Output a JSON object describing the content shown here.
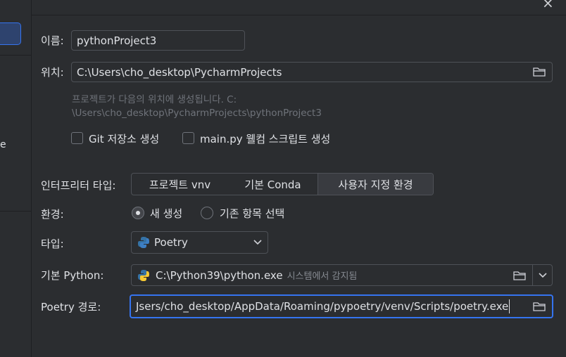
{
  "sidebar": {
    "fragment": "e"
  },
  "form": {
    "name_label": "이름:",
    "name_value": "pythonProject3",
    "location_label": "위치:",
    "location_value": "C:\\Users\\cho_desktop\\PycharmProjects",
    "hint_line1": "프로젝트가 다음의 위치에 생성됩니다. C:",
    "hint_line2": "\\Users\\cho_desktop\\PycharmProjects\\pythonProject3",
    "git_checkbox_label": "Git 저장소 생성",
    "mainpy_checkbox_label": "main.py 웰컴 스크립트 생성",
    "interpreter_label": "인터프리터 타입:",
    "interpreter_tabs": [
      "프로젝트 vnv",
      "기본 Conda",
      "사용자 지정 환경"
    ],
    "interpreter_selected": "사용자 지정 환경",
    "env_label": "환경:",
    "env_options": [
      "새 생성",
      "기존 항목 선택"
    ],
    "env_selected": "새 생성",
    "type_label": "타입:",
    "type_value": "Poetry",
    "base_python_label": "기본 Python:",
    "base_python_value": "C:\\Python39\\python.exe",
    "base_python_note": "시스템에서 감지됨",
    "poetry_path_label": "Poetry 경로:",
    "poetry_path_value": "Jsers/cho_desktop/AppData/Roaming/pypoetry/venv/Scripts/poetry.exe"
  },
  "icons": {
    "close": "close-icon",
    "folder": "folder-icon",
    "chevron": "chevron-down-icon",
    "poetry": "poetry-icon",
    "python": "python-icon"
  },
  "colors": {
    "accent": "#3574f0",
    "background": "#2b2d30",
    "field_border": "#4e5157"
  }
}
